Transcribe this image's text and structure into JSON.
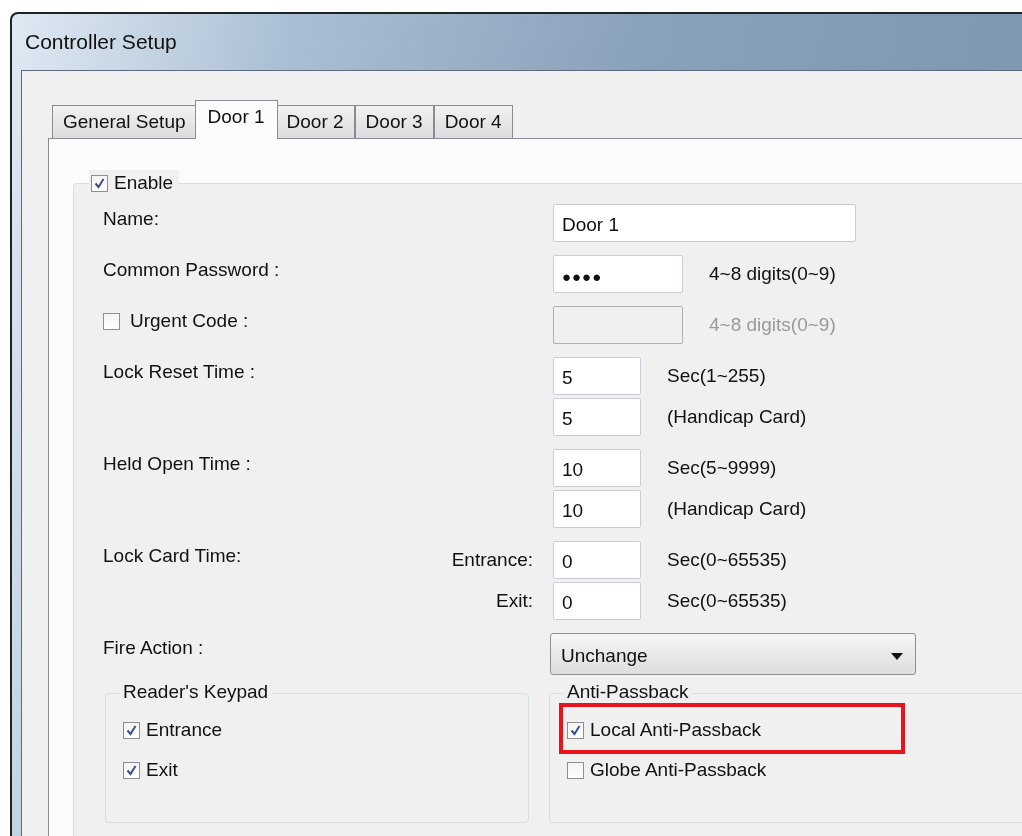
{
  "window": {
    "title": "Controller Setup"
  },
  "tabs": [
    {
      "label": "General Setup",
      "selected": false
    },
    {
      "label": "Door 1",
      "selected": true
    },
    {
      "label": "Door 2",
      "selected": false
    },
    {
      "label": "Door 3",
      "selected": false
    },
    {
      "label": "Door 4",
      "selected": false
    }
  ],
  "enable": {
    "label": "Enable",
    "checked": true
  },
  "rows": [
    {
      "kind": "text",
      "label": "Name:",
      "entries": [
        {
          "value": "Door 1"
        }
      ]
    },
    {
      "kind": "password",
      "label": "Common Password :",
      "entries": [
        {
          "value": "●●●●",
          "hint": "4~8 digits(0~9)"
        }
      ]
    },
    {
      "kind": "password",
      "label": "Urgent Code :",
      "checked": false,
      "entries": [
        {
          "hint": "4~8 digits(0~9)",
          "disabled": true
        }
      ]
    },
    {
      "kind": "number",
      "label": "Lock Reset Time :",
      "entries": [
        {
          "value": "5",
          "hint": "Sec(1~255)"
        },
        {
          "value": "5",
          "hint": "(Handicap Card)"
        }
      ]
    },
    {
      "kind": "number",
      "label": "Held Open Time :",
      "entries": [
        {
          "value": "10",
          "hint": "Sec(5~9999)"
        },
        {
          "value": "10",
          "hint": "(Handicap Card)"
        }
      ]
    },
    {
      "kind": "number",
      "label": "Lock Card Time:",
      "entries": [
        {
          "sublabel": "Entrance:",
          "value": "0",
          "hint": "Sec(0~65535)"
        },
        {
          "sublabel": "Exit:",
          "value": "0",
          "hint": "Sec(0~65535)"
        }
      ]
    },
    {
      "kind": "select",
      "label": "Fire Action :",
      "entries": [
        {
          "value": "Unchange"
        }
      ]
    }
  ],
  "groups": [
    {
      "title": "Reader's Keypad",
      "items": [
        {
          "label": "Entrance",
          "checked": true,
          "highlighted": false
        },
        {
          "label": "Exit",
          "checked": true,
          "highlighted": false
        }
      ]
    },
    {
      "title": "Anti-Passback",
      "items": [
        {
          "label": "Local Anti-Passback",
          "checked": true,
          "highlighted": true
        },
        {
          "label": "Globe Anti-Passback",
          "checked": false,
          "highlighted": false
        }
      ]
    }
  ]
}
